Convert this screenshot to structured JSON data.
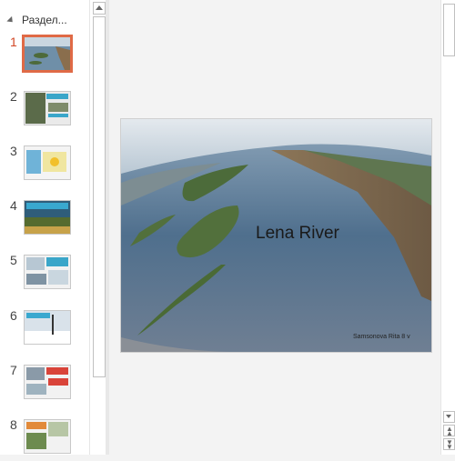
{
  "section": {
    "label": "Раздел..."
  },
  "slides": [
    {
      "number": "1"
    },
    {
      "number": "2"
    },
    {
      "number": "3"
    },
    {
      "number": "4"
    },
    {
      "number": "5"
    },
    {
      "number": "6"
    },
    {
      "number": "7"
    },
    {
      "number": "8"
    }
  ],
  "active_slide": {
    "title": "Lena River",
    "author": "Samsonova Rita 8 v"
  },
  "colors": {
    "active_thumb_border": "#e06a46",
    "active_number": "#d24726"
  }
}
